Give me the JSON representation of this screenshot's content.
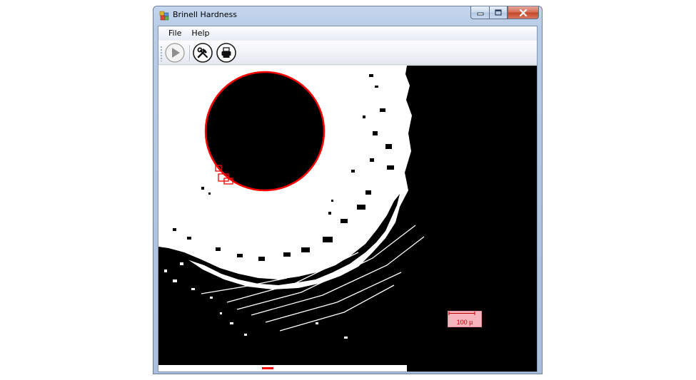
{
  "window": {
    "title": "Brinell Hardness",
    "app_icon": "app-icon",
    "caption_buttons": [
      "minimize-icon",
      "maximize-icon",
      "close-icon"
    ]
  },
  "menu": {
    "items": [
      {
        "label": "File"
      },
      {
        "label": "Help"
      }
    ]
  },
  "toolbar": {
    "buttons": [
      {
        "icon": "play-icon",
        "enabled": false
      },
      {
        "icon": "tools-icon",
        "enabled": true
      },
      {
        "icon": "printer-icon",
        "enabled": true
      }
    ]
  },
  "image": {
    "scale_bar_label": "100 µ",
    "indentation_outline_color": "#ff0000",
    "scale_bar_color": "#f7b4bc"
  }
}
